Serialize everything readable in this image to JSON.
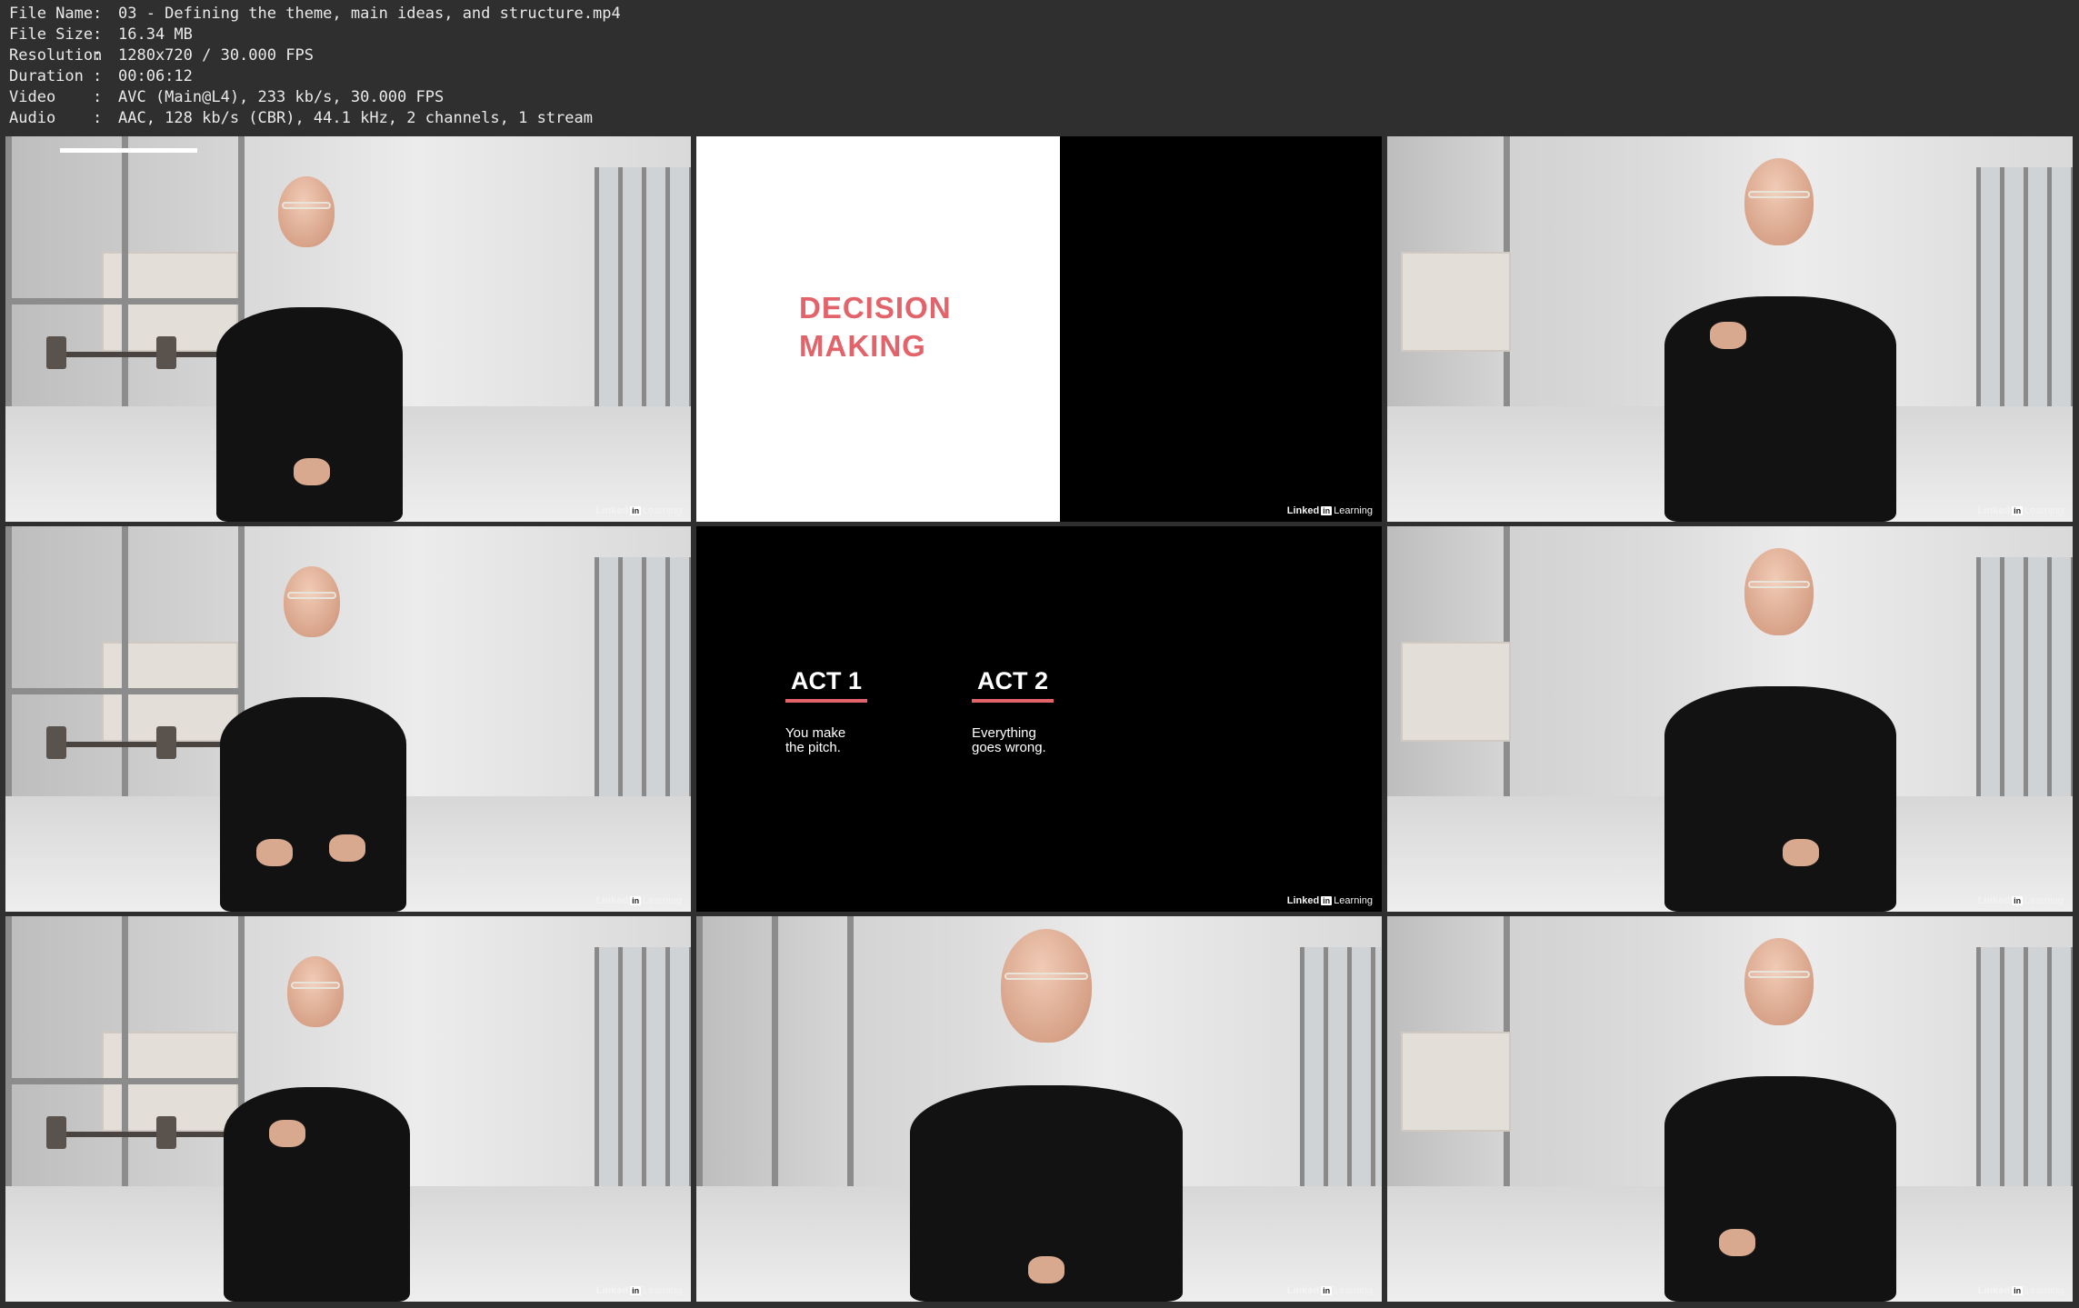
{
  "metadata": [
    {
      "key": "File Name",
      "value": "03 - Defining the theme, main ideas, and structure.mp4"
    },
    {
      "key": "File Size",
      "value": "16.34 MB"
    },
    {
      "key": "Resolution",
      "value": "1280x720 / 30.000 FPS"
    },
    {
      "key": "Duration",
      "value": "00:06:12"
    },
    {
      "key": "Video",
      "value": "AVC (Main@L4), 233 kb/s, 30.000 FPS"
    },
    {
      "key": "Audio",
      "value": "AAC, 128 kb/s (CBR), 44.1 kHz, 2 channels, 1 stream"
    }
  ],
  "separator": ":",
  "watermark": {
    "brand": "Linked",
    "in": "in",
    "product": "Learning"
  },
  "slides": {
    "decision": {
      "line1": "DECISION",
      "line2": "MAKING"
    },
    "acts": [
      {
        "title": "ACT 1",
        "line1": "You make",
        "line2": "the pitch."
      },
      {
        "title": "ACT 2",
        "line1": "Everything",
        "line2": "goes wrong."
      }
    ]
  },
  "colors": {
    "accent": "#e3636a",
    "background": "#2f2f2f"
  }
}
